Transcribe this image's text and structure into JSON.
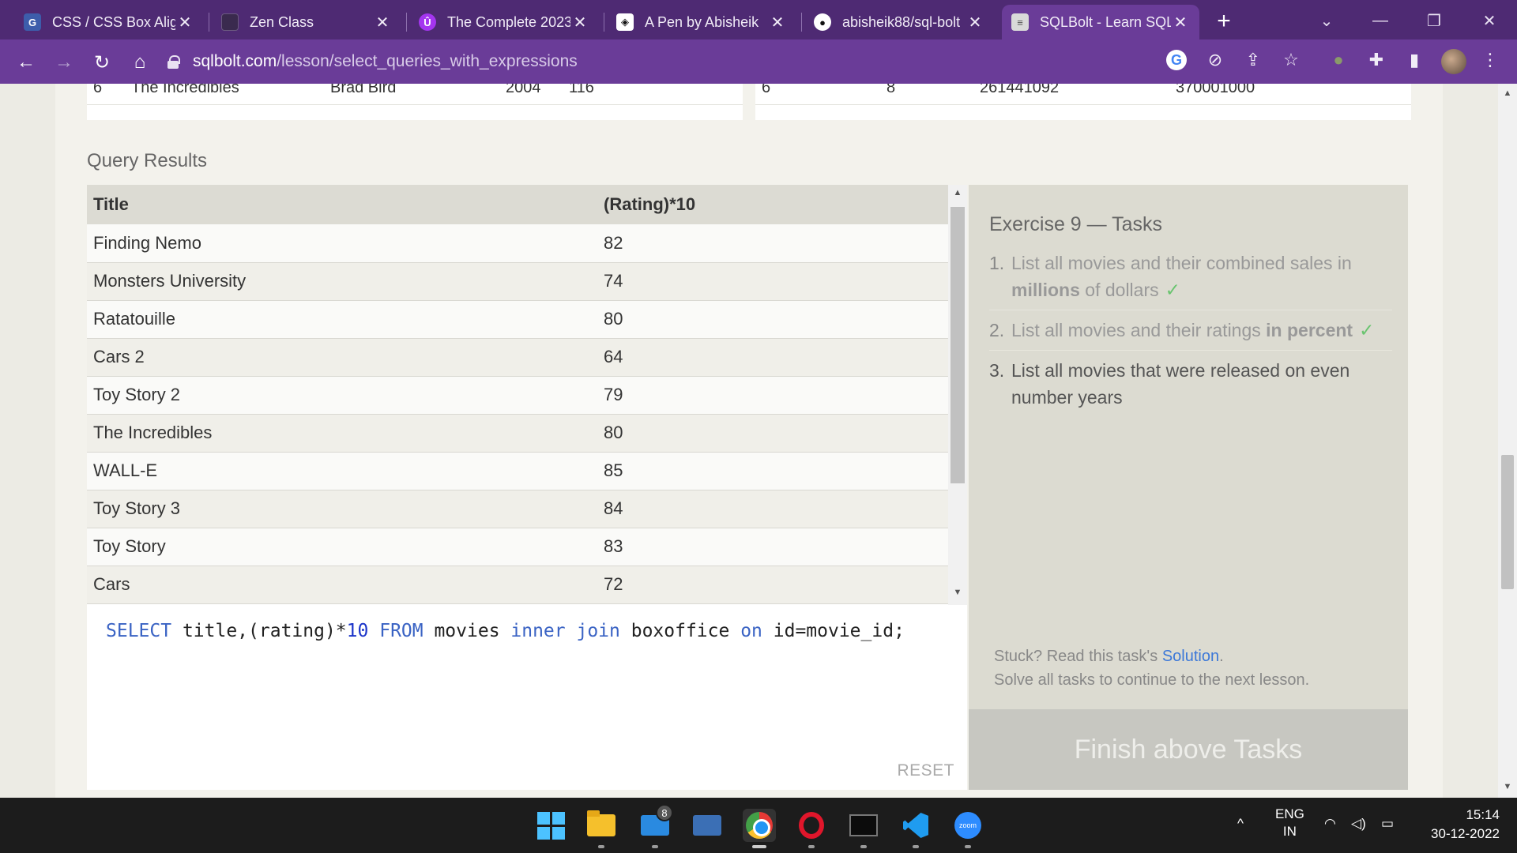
{
  "browser": {
    "tabs": [
      {
        "label": "CSS / CSS Box Alignment",
        "icon": "css-favicon-icon"
      },
      {
        "label": "Zen Class",
        "icon": "zen-favicon-icon"
      },
      {
        "label": "The Complete 2023",
        "icon": "udemy-favicon-icon"
      },
      {
        "label": "A Pen by Abisheik",
        "icon": "codepen-favicon-icon"
      },
      {
        "label": "abisheik88/sql-bolt",
        "icon": "github-favicon-icon"
      },
      {
        "label": "SQLBolt - Learn SQL",
        "icon": "sqlbolt-favicon-icon"
      }
    ],
    "active_tab": 5,
    "new_tab": "+",
    "url_host": "sqlbolt.com",
    "url_path": "/lesson/select_queries_with_expressions"
  },
  "previous_table": {
    "row_a": [
      "6",
      "The Incredibles",
      "Brad Bird",
      "2004",
      "116"
    ],
    "row_b": [
      "6",
      "8",
      "261441092",
      "370001000"
    ]
  },
  "query_results": {
    "title": "Query Results",
    "columns": [
      "Title",
      "(Rating)*10"
    ],
    "rows": [
      [
        "Finding Nemo",
        "82"
      ],
      [
        "Monsters University",
        "74"
      ],
      [
        "Ratatouille",
        "80"
      ],
      [
        "Cars 2",
        "64"
      ],
      [
        "Toy Story 2",
        "79"
      ],
      [
        "The Incredibles",
        "80"
      ],
      [
        "WALL-E",
        "85"
      ],
      [
        "Toy Story 3",
        "84"
      ],
      [
        "Toy Story",
        "83"
      ],
      [
        "Cars",
        "72"
      ]
    ]
  },
  "editor": {
    "tokens": [
      {
        "t": "SELECT",
        "c": "kw"
      },
      {
        "t": " title,(rating)*",
        "c": ""
      },
      {
        "t": "10",
        "c": "num"
      },
      {
        "t": " ",
        "c": ""
      },
      {
        "t": "FROM",
        "c": "kw"
      },
      {
        "t": " movies ",
        "c": ""
      },
      {
        "t": "inner join",
        "c": "kw"
      },
      {
        "t": " boxoffice ",
        "c": ""
      },
      {
        "t": "on",
        "c": "kw"
      },
      {
        "t": " id=movie_id;",
        "c": ""
      }
    ],
    "reset_label": "RESET"
  },
  "tasks": {
    "title": "Exercise 9 — Tasks",
    "task1_pre": "List all movies and their combined sales in ",
    "task1_bold": "millions",
    "task1_post": " of dollars",
    "task2_pre": "List all movies and their ratings ",
    "task2_bold": "in percent",
    "task3": "List all movies that were released on even number years",
    "check": "✓",
    "stuck_pre": "Stuck? Read this task's ",
    "stuck_link": "Solution",
    "stuck_post": ".",
    "solve_note": "Solve all tasks to continue to the next lesson.",
    "finish_label": "Finish above Tasks"
  },
  "taskbar": {
    "mail_badge": "8",
    "zoom_label": "zoom",
    "lang_line1": "ENG",
    "lang_line2": "IN",
    "time": "15:14",
    "date": "30-12-2022"
  },
  "colors": {
    "chrome_purple": "#4e2a73",
    "chrome_purple_active": "#6a3c98",
    "check_green": "#69c46f",
    "link_blue": "#3c78d8",
    "sql_keyword": "#3a63c4"
  }
}
